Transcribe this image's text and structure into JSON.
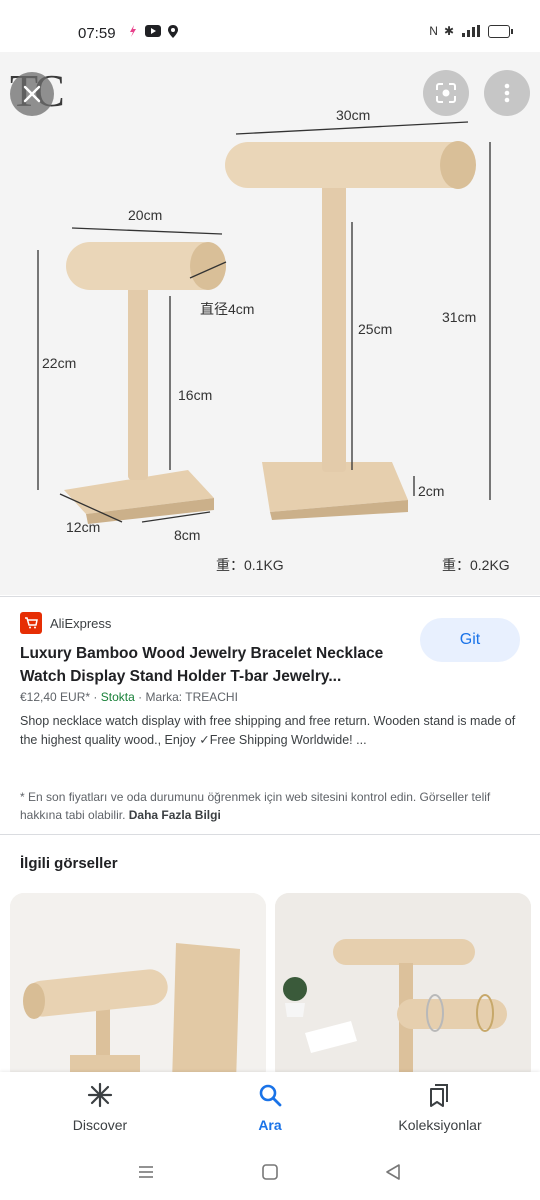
{
  "status_bar": {
    "time": "07:59",
    "right_icons": [
      "nfc-icon",
      "bluetooth-icon",
      "signal-icon",
      "battery-icon"
    ],
    "left_icons": [
      "notification-icon",
      "youtube-icon",
      "location-icon"
    ]
  },
  "viewer": {
    "logo_text": "TC",
    "dimensions": {
      "big_width": "30cm",
      "small_width": "20cm",
      "diameter": "直径4cm",
      "small_total": "22cm",
      "small_pole": "16cm",
      "big_pole": "25cm",
      "big_total": "31cm",
      "base_height": "2cm",
      "base_depth": "12cm",
      "base_width": "8cm",
      "weight_small": "重：0.1KG",
      "weight_big": "重：0.2KG"
    }
  },
  "result": {
    "source": "AliExpress",
    "visit_label": "Git",
    "title": "Luxury Bamboo Wood Jewelry Bracelet Necklace Watch Display Stand Holder T-bar Jewelry...",
    "price": "€12,40 EUR*",
    "stock": "Stokta",
    "brand": "Marka: TREACHI",
    "sep": "·",
    "description": "Shop necklace watch display with free shipping and free return. Wooden stand is made of the highest quality wood., Enjoy ✓Free Shipping Worldwide! ...",
    "notice": "* En son fiyatları ve oda durumunu öğrenmek için web sitesini kontrol edin. Görseller telif hakkına tabi olabilir.",
    "more_info": "Daha Fazla Bilgi"
  },
  "related": {
    "title": "İlgili görseller"
  },
  "bottom_nav": {
    "items": [
      {
        "label": "Discover",
        "icon": "asterisk-icon"
      },
      {
        "label": "Ara",
        "icon": "search-icon"
      },
      {
        "label": "Koleksiyonlar",
        "icon": "collections-icon"
      }
    ],
    "active": "Ara"
  },
  "colors": {
    "accent": "#1a73e8",
    "wood": "#e8d3b3",
    "stock": "#188038",
    "aliexpress": "#e62e04"
  }
}
